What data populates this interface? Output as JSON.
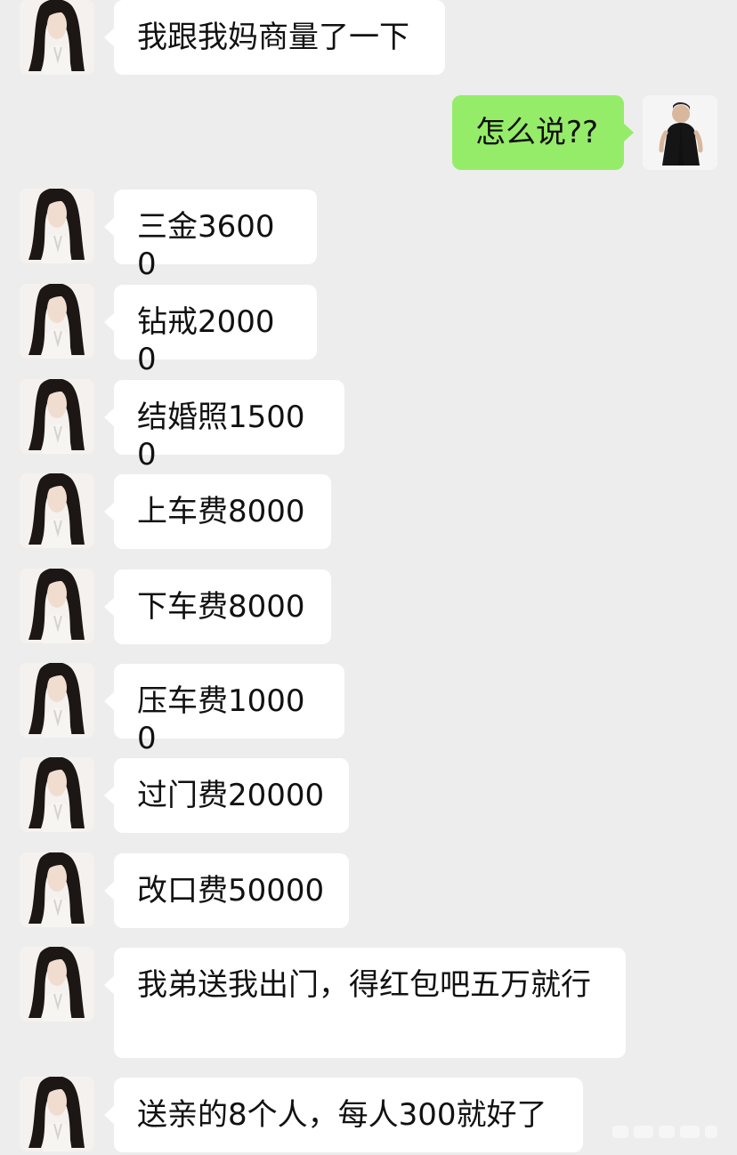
{
  "messages": [
    {
      "sender": "contact",
      "text": "我跟我妈商量了一下"
    },
    {
      "sender": "me",
      "text": "怎么说??"
    },
    {
      "sender": "contact",
      "text": "三金36000"
    },
    {
      "sender": "contact",
      "text": "钻戒20000"
    },
    {
      "sender": "contact",
      "text": "结婚照15000"
    },
    {
      "sender": "contact",
      "text": "上车费8000"
    },
    {
      "sender": "contact",
      "text": "下车费8000"
    },
    {
      "sender": "contact",
      "text": "压车费10000"
    },
    {
      "sender": "contact",
      "text": "过门费20000"
    },
    {
      "sender": "contact",
      "text": "改口费50000"
    },
    {
      "sender": "contact",
      "text": "我弟送我出门，得红包吧五万就行"
    },
    {
      "sender": "contact",
      "text": "送亲的8个人，每人300就好了"
    }
  ],
  "colors": {
    "background": "#ededed",
    "incoming_bubble": "#ffffff",
    "outgoing_bubble": "#95ec69",
    "text": "#111111"
  },
  "icons": {
    "contact_avatar": "woman-portrait-avatar",
    "my_avatar": "man-portrait-avatar"
  }
}
